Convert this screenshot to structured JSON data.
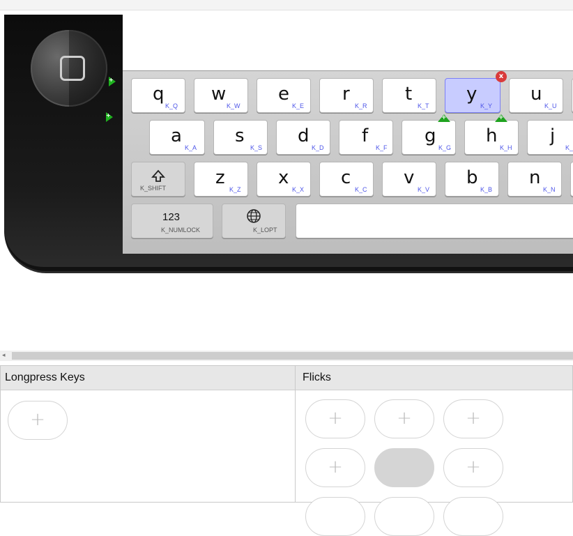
{
  "keyboard": {
    "rows": [
      [
        {
          "cap": "q",
          "code": "K_Q"
        },
        {
          "cap": "w",
          "code": "K_W"
        },
        {
          "cap": "e",
          "code": "K_E"
        },
        {
          "cap": "r",
          "code": "K_R"
        },
        {
          "cap": "t",
          "code": "K_T"
        },
        {
          "cap": "y",
          "code": "K_Y"
        },
        {
          "cap": "u",
          "code": "K_U"
        }
      ],
      [
        {
          "cap": "a",
          "code": "K_A"
        },
        {
          "cap": "s",
          "code": "K_S"
        },
        {
          "cap": "d",
          "code": "K_D"
        },
        {
          "cap": "f",
          "code": "K_F"
        },
        {
          "cap": "g",
          "code": "K_G"
        },
        {
          "cap": "h",
          "code": "K_H"
        },
        {
          "cap": "j",
          "code": "K_"
        }
      ],
      [
        {
          "cap": "z",
          "code": "K_Z"
        },
        {
          "cap": "x",
          "code": "K_X"
        },
        {
          "cap": "c",
          "code": "K_C"
        },
        {
          "cap": "v",
          "code": "K_V"
        },
        {
          "cap": "b",
          "code": "K_B"
        },
        {
          "cap": "n",
          "code": "K_N"
        }
      ]
    ],
    "shift": {
      "icon": "shift-icon",
      "code": "K_SHIFT"
    },
    "numlock": {
      "label": "123",
      "code": "K_NUMLOCK"
    },
    "lopt": {
      "icon": "globe-icon",
      "code": "K_LOPT"
    },
    "selected_key": "y"
  },
  "panels": {
    "longpress": {
      "title": "Longpress Keys",
      "add_label": "+"
    },
    "flicks": {
      "title": "Flicks",
      "add_label": "+"
    }
  }
}
